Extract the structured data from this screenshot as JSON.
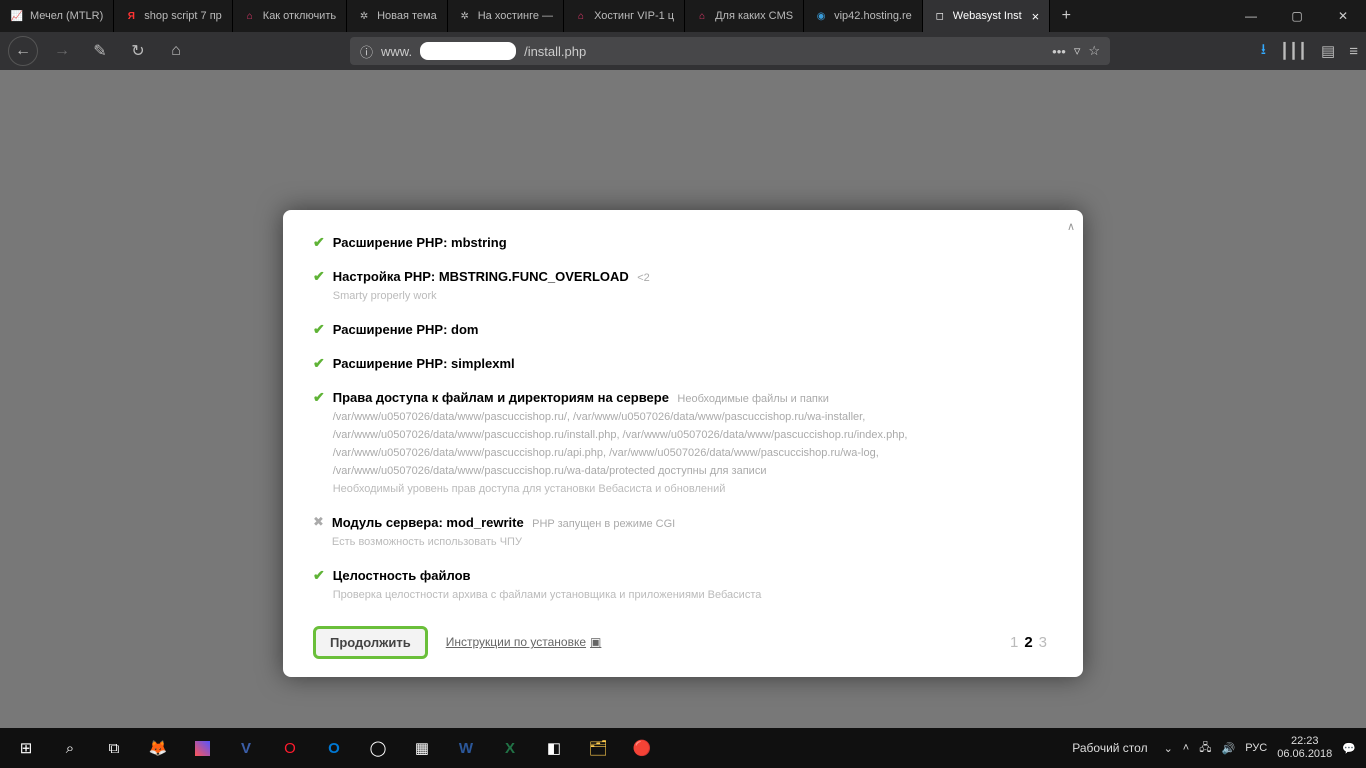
{
  "browser": {
    "tabs": [
      {
        "label": "Мечел (MTLR)",
        "favcolor": "#e24"
      },
      {
        "label": "shop script 7 пр",
        "favglyph": "Я",
        "favcolor": "#f33"
      },
      {
        "label": "Как отключить",
        "favcolor": "#e73a6e"
      },
      {
        "label": "Новая тема",
        "favcolor": "#888"
      },
      {
        "label": "На хостинге —",
        "favcolor": "#888"
      },
      {
        "label": "Хостинг VIP-1 ц",
        "favcolor": "#e73a6e"
      },
      {
        "label": "Для каких CMS",
        "favcolor": "#e73a6e"
      },
      {
        "label": "vip42.hosting.re",
        "favcolor": "#3a7ed7"
      },
      {
        "label": "Webasyst Inst",
        "favcolor": "#fff",
        "active": true
      }
    ],
    "url_prefix": "www.",
    "url_suffix": "/install.php",
    "toolbar_icons": {
      "dots": "•••",
      "pocket": "⌄",
      "menu": "≡",
      "download": "⭳",
      "library": "┃┃┃",
      "reader": "▤"
    }
  },
  "win": {
    "min": "—",
    "max": "▢",
    "close": "✕"
  },
  "installer": {
    "checks": [
      {
        "status": "pass",
        "title": "Расширение PHP: mbstring"
      },
      {
        "status": "pass",
        "title": "Настройка PHP: MBSTRING.FUNC_OVERLOAD",
        "note": "<2",
        "desc": "Smarty properly work"
      },
      {
        "status": "pass",
        "title": "Расширение PHP: dom"
      },
      {
        "status": "pass",
        "title": "Расширение PHP: simplexml"
      },
      {
        "status": "pass",
        "title": "Права доступа к файлам и директориям на сервере",
        "note": "Необходимые файлы и папки /var/www/u0507026/data/www/pascuccishop.ru/, /var/www/u0507026/data/www/pascuccishop.ru/wa-installer, /var/www/u0507026/data/www/pascuccishop.ru/install.php, /var/www/u0507026/data/www/pascuccishop.ru/index.php, /var/www/u0507026/data/www/pascuccishop.ru/api.php, /var/www/u0507026/data/www/pascuccishop.ru/wa-log, /var/www/u0507026/data/www/pascuccishop.ru/wa-data/protected доступны для записи",
        "desc": "Необходимый уровень прав доступа для установки Вебасиста и обновлений"
      },
      {
        "status": "warn",
        "title": "Модуль сервера: mod_rewrite",
        "note": "PHP запущен в режиме CGI",
        "desc": "Есть возможность использовать ЧПУ"
      },
      {
        "status": "pass",
        "title": "Целостность файлов",
        "desc": "Проверка целостности архива с файлами установщика и приложениями Вебасиста"
      }
    ],
    "continue": "Продолжить",
    "instructions": "Инструкции по установке",
    "pager": {
      "p1": "1",
      "p2": "2",
      "p3": "3",
      "current": 2
    }
  },
  "taskbar": {
    "desktop_label": "Рабочий стол",
    "lang": "РУС",
    "time": "22:23",
    "date": "06.06.2018"
  }
}
